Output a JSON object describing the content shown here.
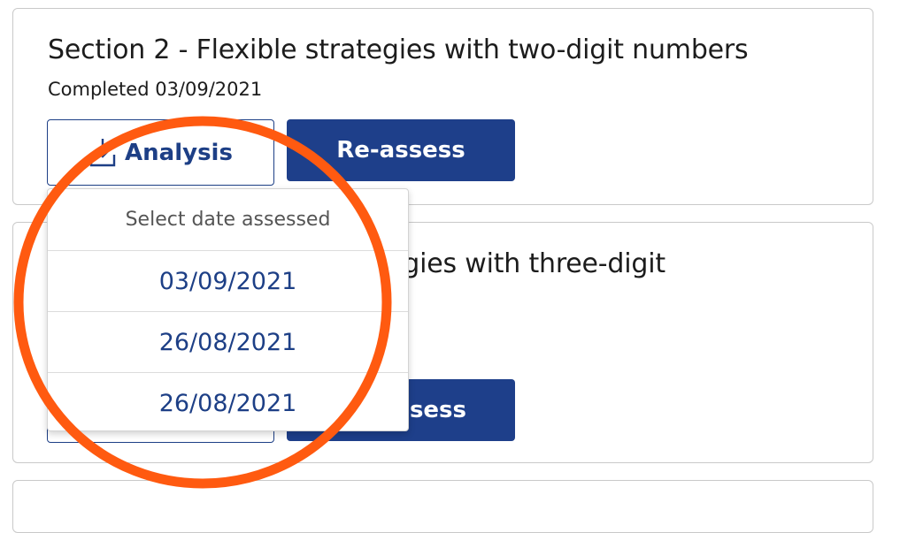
{
  "sections": [
    {
      "title": "Section 2 - Flexible strategies with two-digit numbers",
      "completed": "Completed 03/09/2021",
      "analysis_label": "Analysis",
      "reassess_label": "Re-assess"
    },
    {
      "title_visible": "egies with three-digit",
      "reassess_visible": "sess"
    }
  ],
  "dropdown": {
    "header": "Select date assessed",
    "items": [
      "03/09/2021",
      "26/08/2021",
      "26/08/2021"
    ]
  },
  "icons": {
    "analysis_icon": "download-icon"
  },
  "colors": {
    "primary": "#1e3f8a",
    "highlight": "#ff5a10"
  }
}
